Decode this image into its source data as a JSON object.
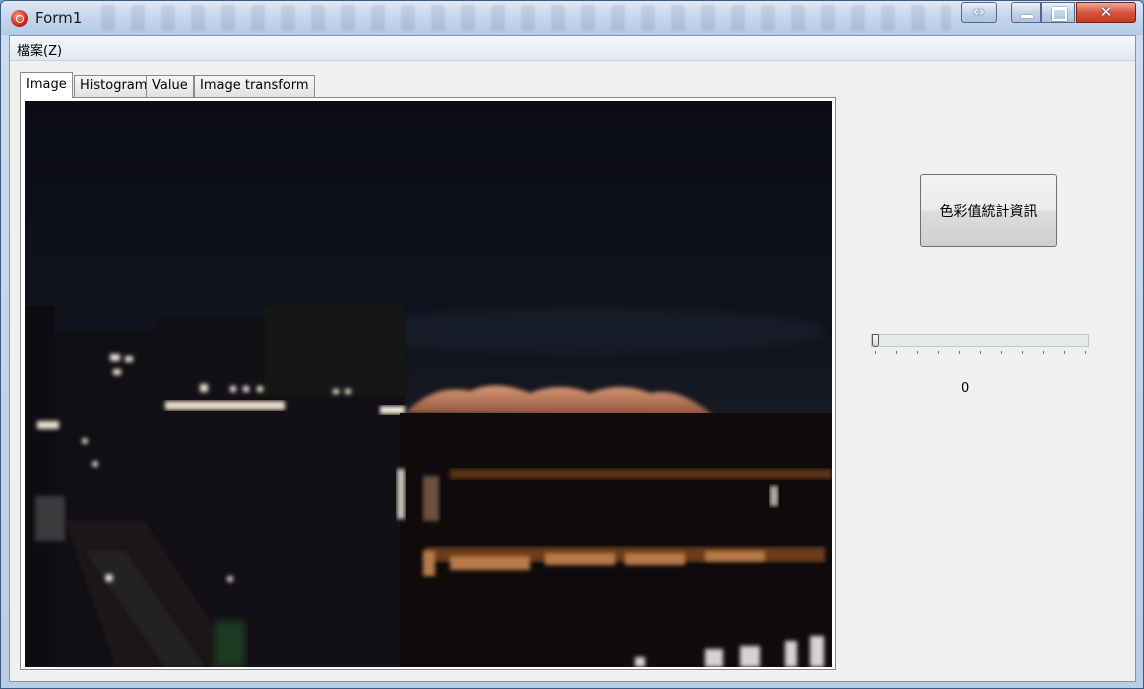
{
  "window": {
    "title": "Form1",
    "icon": "app-icon",
    "controls": [
      "swap-icon",
      "minimize-icon",
      "maximize-icon",
      "close-icon"
    ]
  },
  "menu": {
    "items": [
      {
        "label": "檔案(Z)"
      }
    ]
  },
  "tabs": [
    {
      "label": "Image",
      "active": true
    },
    {
      "label": "Histogram",
      "active": false
    },
    {
      "label": "Value",
      "active": false
    },
    {
      "label": "Image transform",
      "active": false
    }
  ],
  "image": {
    "description_kind": "night-cityscape-photo"
  },
  "side_panel": {
    "stats_button_label": "色彩值統計資訊",
    "slider": {
      "min": 0,
      "max": 20,
      "value": 0
    },
    "slider_value_text": "0"
  },
  "colors": {
    "close_button": "#d9543f",
    "titlebar": "#c4d6ed",
    "client_background": "#f0f0f0"
  }
}
